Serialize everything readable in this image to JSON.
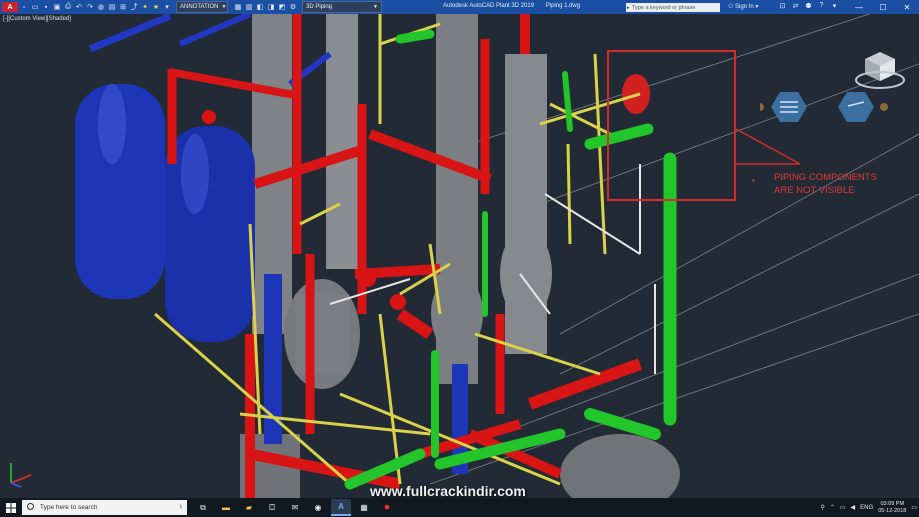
{
  "window": {
    "app_title": "Autodesk AutoCAD Plant 3D 2019",
    "file_title": "Piping 1.dwg",
    "workspace": "3D Piping",
    "annotation_scale": "ANNOTATION",
    "search_placeholder": "Type a keyword or phrase",
    "sign_in": "Sign In",
    "controls": {
      "minimize": "—",
      "maximize": "☐",
      "close": "✕"
    }
  },
  "viewport": {
    "label": "[-][Custom View][Shaded]",
    "annotation": {
      "line1": "PIPING COMPONENTS",
      "line2": "ARE NOT VISIBLE",
      "bullet": "•"
    },
    "watermark": "www.fullcrackindir.com",
    "colors": {
      "background": "#222a35",
      "vessel": "#1d36b8",
      "pipe_red": "#d81414",
      "pipe_yellow": "#d9d24a",
      "pipe_green": "#22c52a",
      "pipe_grey": "#8a8d90",
      "annotation": "#d42a2a"
    }
  },
  "taskbar": {
    "search_placeholder": "Type here to search",
    "apps": [
      "task-view-icon",
      "file-explorer-icon",
      "store-icon",
      "mail-icon",
      "media-icon",
      "autocad-icon",
      "calculator-icon",
      "pdf-icon"
    ],
    "lang": "ENG",
    "time": "03:09 PM",
    "date": "05-12-2018"
  }
}
